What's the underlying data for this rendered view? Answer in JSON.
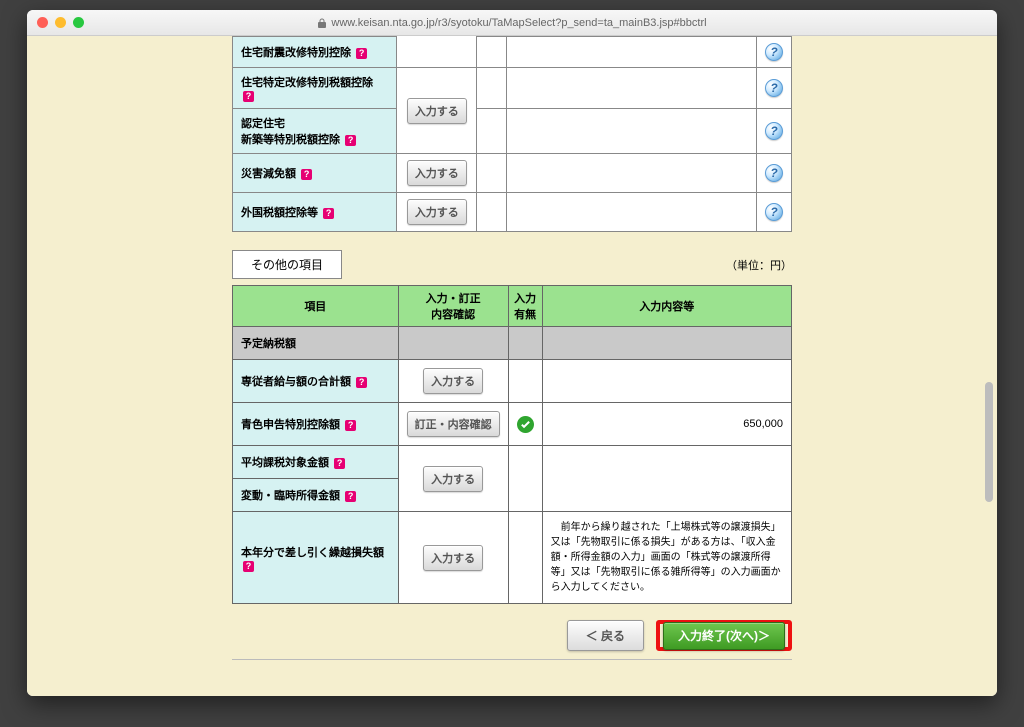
{
  "url": "www.keisan.nta.go.jp/r3/syotoku/TaMapSelect?p_send=ta_mainB3.jsp#bbctrl",
  "upper_rows": [
    {
      "label": "住宅耐震改修特別控除",
      "help": true,
      "button": null
    },
    {
      "label": "住宅特定改修特別税額控除",
      "help": true,
      "button": "入力する"
    },
    {
      "label_lines": [
        "認定住宅",
        "新築等特別税額控除"
      ],
      "help": true,
      "button": null
    },
    {
      "label": "災害減免額",
      "help": true,
      "button": "入力する"
    },
    {
      "label": "外国税額控除等",
      "help": true,
      "button": "入力する"
    }
  ],
  "section": {
    "tab": "その他の項目",
    "unit": "（単位：円）"
  },
  "lower_headers": {
    "item": "項目",
    "confirm": "入力・訂正\n内容確認",
    "flag": "入力\n有無",
    "value": "入力内容等"
  },
  "lower_rows": [
    {
      "kind": "scheduled",
      "label": "予定納税額"
    },
    {
      "label": "専従者給与額の合計額",
      "help": true,
      "button": "入力する"
    },
    {
      "label": "青色申告特別控除額",
      "help": true,
      "button": "訂正・内容確認",
      "checked": true,
      "value": "650,000",
      "value_align": "right"
    },
    {
      "label": "平均課税対象金額",
      "help": true,
      "merge_button": "入力する"
    },
    {
      "label": "変動・臨時所得金額",
      "help": true,
      "merge_continue": true
    },
    {
      "label": "本年分で差し引く繰越損失額",
      "help": true,
      "button": "入力する",
      "note": "　前年から繰り越された「上場株式等の譲渡損失」又は「先物取引に係る損失」がある方は、「収入金額・所得金額の入力」画面の「株式等の譲渡所得等」又は「先物取引に係る雑所得等」の入力画面から入力してください。"
    }
  ],
  "buttons": {
    "back": "＜ 戻る",
    "next": "入力終了(次へ)＞"
  }
}
